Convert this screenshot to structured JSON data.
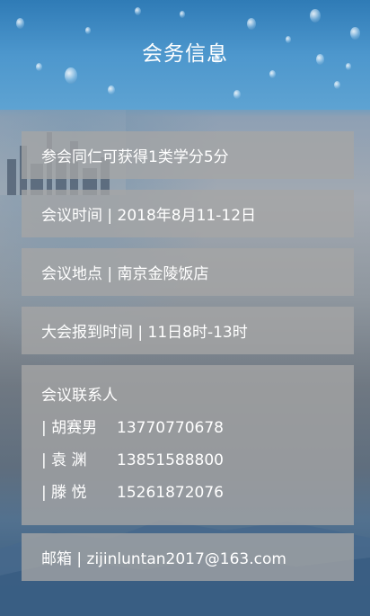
{
  "header": {
    "title": "会务信息"
  },
  "info_items": [
    "参会同仁可获得1类学分5分",
    "会议时间 | 2018年8月11-12日",
    "会议地点 | 南京金陵饭店",
    "大会报到时间 | 11日8时-13时"
  ],
  "contact": {
    "heading": "会议联系人",
    "people": [
      {
        "name": "| 胡赛男",
        "phone": "13770770678"
      },
      {
        "name": "| 袁  渊",
        "phone": "13851588800"
      },
      {
        "name": "| 滕  悦",
        "phone": "15261872076"
      }
    ]
  },
  "email": "邮箱 | zijinluntan2017@163.com"
}
